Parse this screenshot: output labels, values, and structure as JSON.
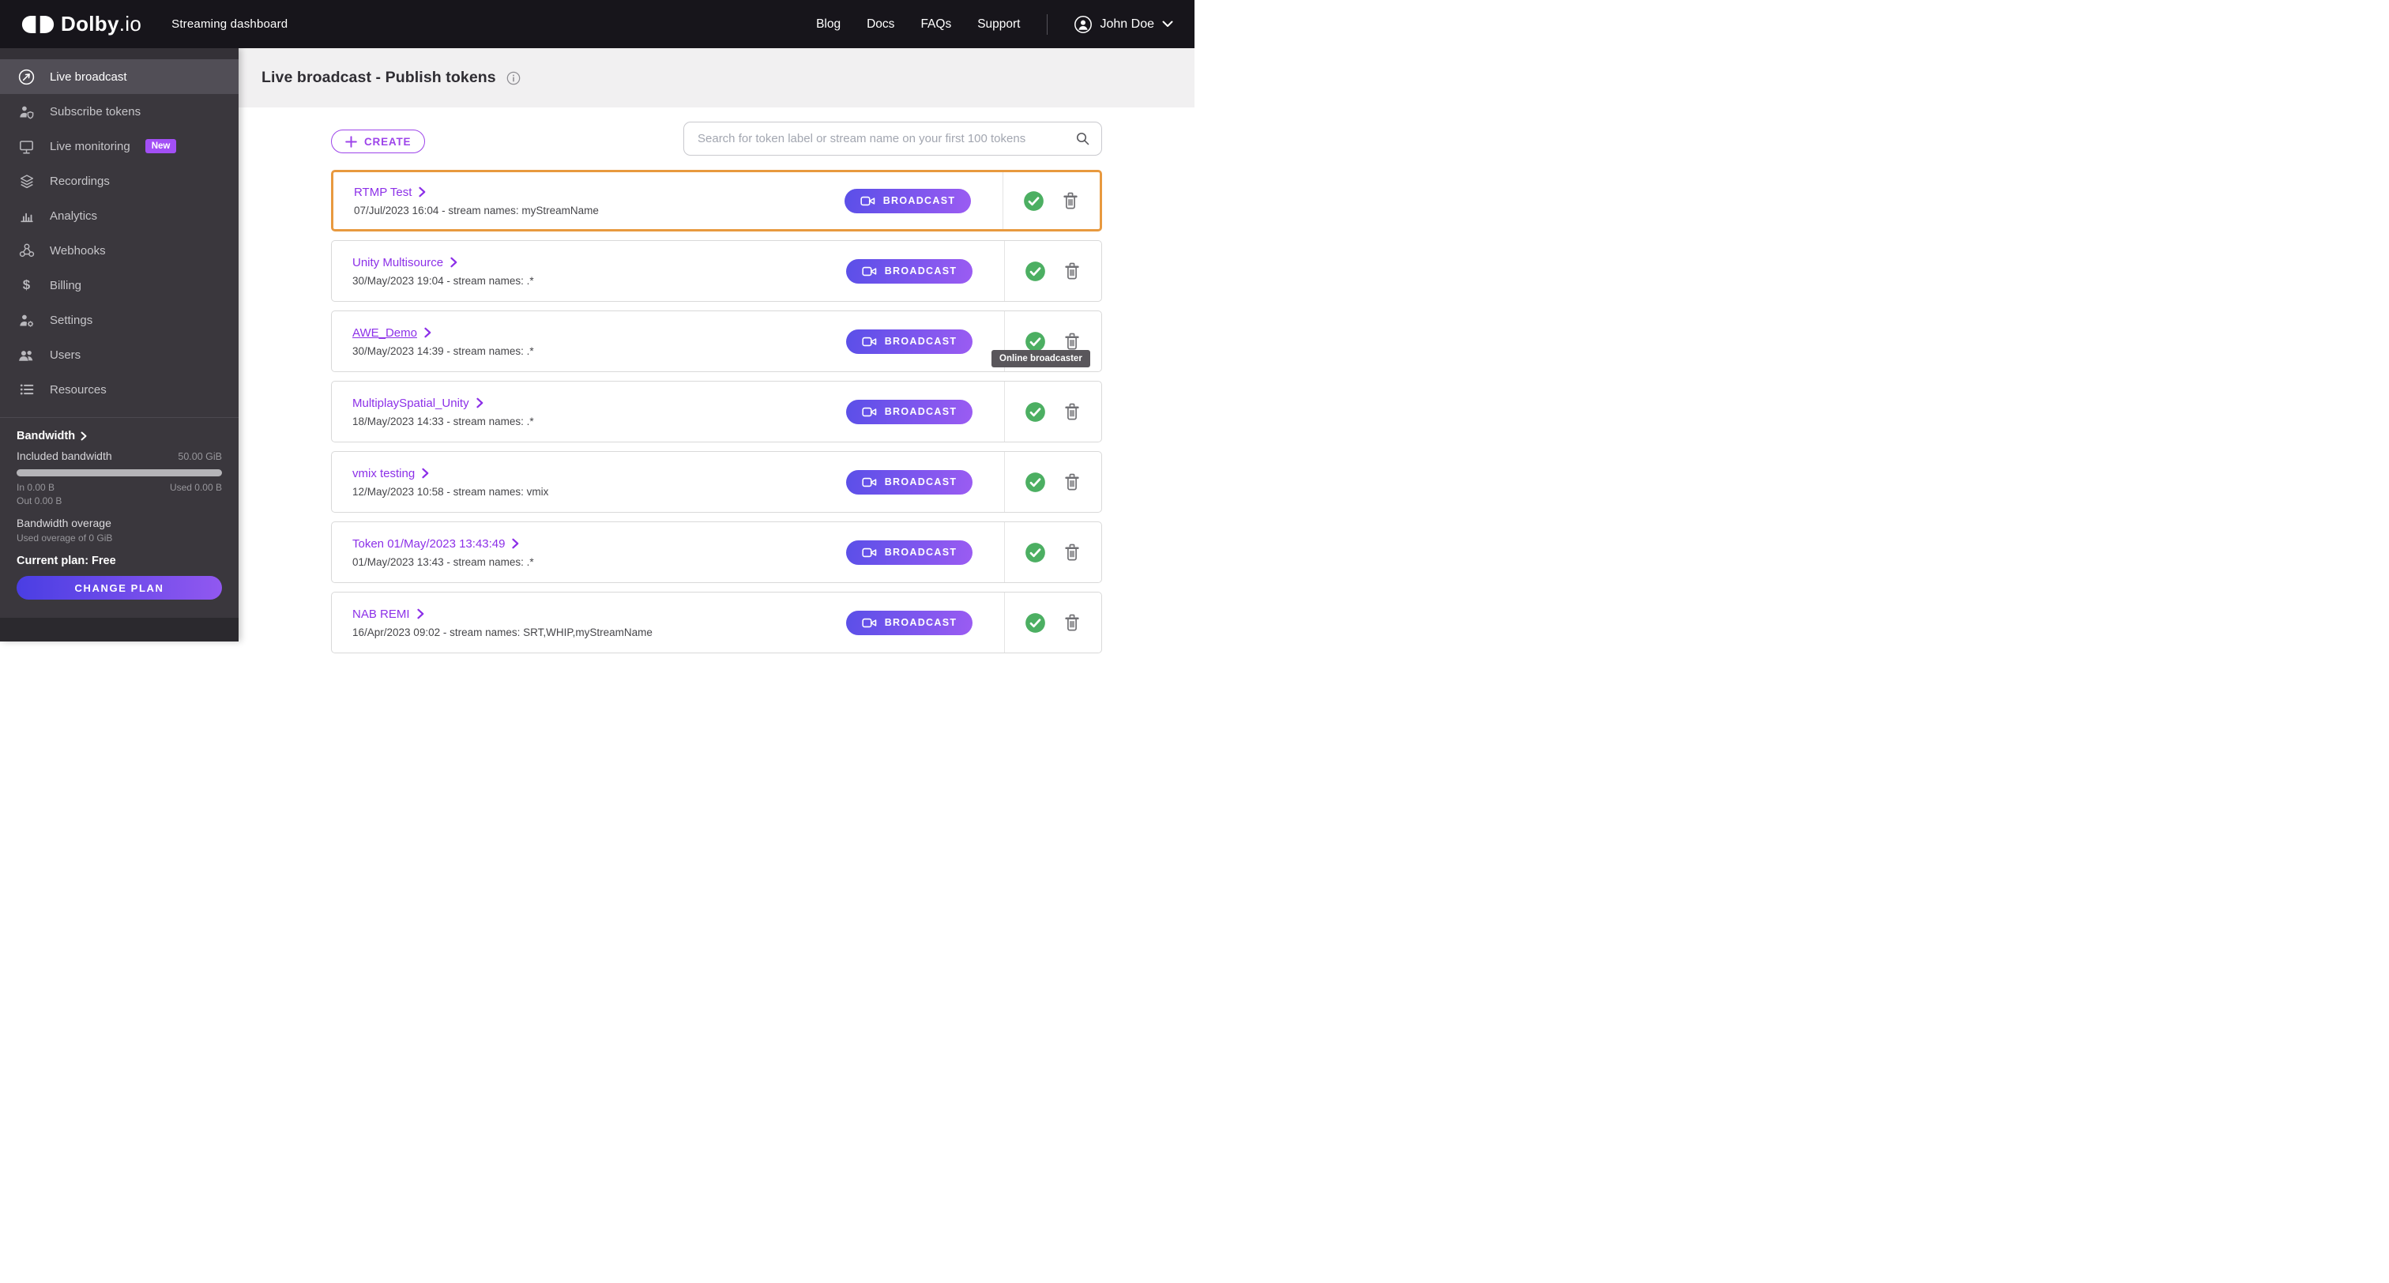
{
  "navbar": {
    "logo_primary": "Dolby",
    "logo_suffix": ".io",
    "app_title": "Streaming dashboard",
    "links": [
      "Blog",
      "Docs",
      "FAQs",
      "Support"
    ],
    "user_name": "John Doe"
  },
  "sidebar": {
    "items": [
      {
        "label": "Live broadcast",
        "active": true
      },
      {
        "label": "Subscribe tokens"
      },
      {
        "label": "Live monitoring",
        "badge": "New"
      },
      {
        "label": "Recordings"
      },
      {
        "label": "Analytics"
      },
      {
        "label": "Webhooks"
      },
      {
        "label": "Billing"
      },
      {
        "label": "Settings"
      },
      {
        "label": "Users"
      },
      {
        "label": "Resources"
      }
    ],
    "bandwidth": {
      "title": "Bandwidth",
      "included_label": "Included bandwidth",
      "included_value": "50.00 GiB",
      "in_label": "In 0.00 B",
      "used_label": "Used 0.00 B",
      "out_label": "Out 0.00 B",
      "overage_title": "Bandwidth overage",
      "overage_detail": "Used overage of 0 GiB",
      "plan_label": "Current plan: Free",
      "change_plan_label": "CHANGE PLAN"
    }
  },
  "header": {
    "title": "Live broadcast - Publish tokens"
  },
  "toolbar": {
    "create_label": "CREATE",
    "search_placeholder": "Search for token label or stream name on your first 100 tokens"
  },
  "row": {
    "broadcast_label": "BROADCAST"
  },
  "tokens": [
    {
      "name": "RTMP Test",
      "meta": "07/Jul/2023 16:04 - stream names: myStreamName",
      "selected": true
    },
    {
      "name": "Unity Multisource",
      "meta": "30/May/2023 19:04 - stream names: .*"
    },
    {
      "name": "AWE_Demo",
      "meta": "30/May/2023 14:39 - stream names: .*",
      "underlined": true,
      "tooltip": "Online broadcaster"
    },
    {
      "name": "MultiplaySpatial_Unity",
      "meta": "18/May/2023 14:33 - stream names: .*"
    },
    {
      "name": "vmix testing",
      "meta": "12/May/2023 10:58 - stream names: vmix"
    },
    {
      "name": "Token 01/May/2023 13:43:49",
      "meta": "01/May/2023 13:43 - stream names: .*"
    },
    {
      "name": "NAB REMI",
      "meta": "16/Apr/2023 09:02 - stream names: SRT,WHIP,myStreamName"
    }
  ],
  "colors": {
    "accent_purple": "#8c30e8",
    "broadcast_gradient_start": "#5a4fe8",
    "broadcast_gradient_end": "#9b5cf2",
    "selected_row_orange": "#e8993f",
    "status_green": "#4caf62",
    "badge_purple": "#a24ff5",
    "navbar_bg": "#17151b",
    "sidebar_bg": "#3a373d"
  }
}
